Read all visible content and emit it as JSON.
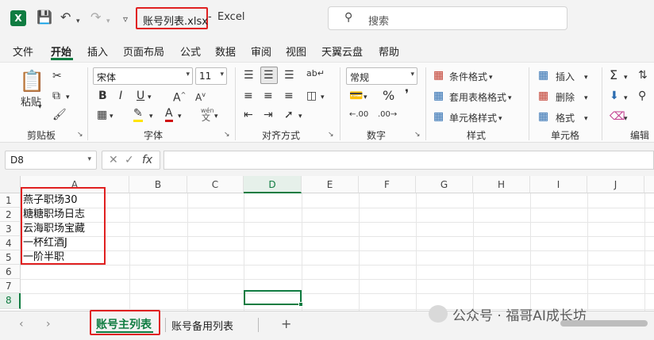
{
  "titlebar": {
    "file_name": "账号列表.xlsx",
    "separator": "-",
    "app_name": "Excel",
    "search_placeholder": "搜索"
  },
  "menu": {
    "items": [
      "文件",
      "开始",
      "插入",
      "页面布局",
      "公式",
      "数据",
      "审阅",
      "视图",
      "天翼云盘",
      "帮助"
    ],
    "active": "开始"
  },
  "ribbon": {
    "clipboard": {
      "paste": "粘贴",
      "label": "剪贴板"
    },
    "font": {
      "name": "宋体",
      "size": "11",
      "label": "字体",
      "phonetic": "wén",
      "phonetic_char": "文"
    },
    "alignment": {
      "label": "对齐方式"
    },
    "number": {
      "format": "常规",
      "label": "数字"
    },
    "styles": {
      "conditional": "条件格式",
      "table_format": "套用表格格式",
      "cell_styles": "单元格样式",
      "label": "样式"
    },
    "cells": {
      "insert": "插入",
      "delete": "删除",
      "format": "格式",
      "label": "单元格"
    },
    "editing": {
      "label": "编辑"
    }
  },
  "formula_bar": {
    "name_box": "D8",
    "fx": "fx",
    "formula": ""
  },
  "sheet": {
    "columns": [
      "A",
      "B",
      "C",
      "D",
      "E",
      "F",
      "G",
      "H",
      "I",
      "J"
    ],
    "active_column": "D",
    "rows": [
      "1",
      "2",
      "3",
      "4",
      "5",
      "6",
      "7",
      "8"
    ],
    "active_row": "8",
    "cells_a": [
      "燕子职场30",
      "糖糖职场日志",
      "云海职场宝藏",
      "一杯红酒J",
      "一阶半职"
    ]
  },
  "tabs": {
    "active": "账号主列表",
    "other": "账号备用列表",
    "add": "+",
    "prev": "‹",
    "next": "›"
  },
  "watermark": "公众号 · 福哥AI成长坊"
}
